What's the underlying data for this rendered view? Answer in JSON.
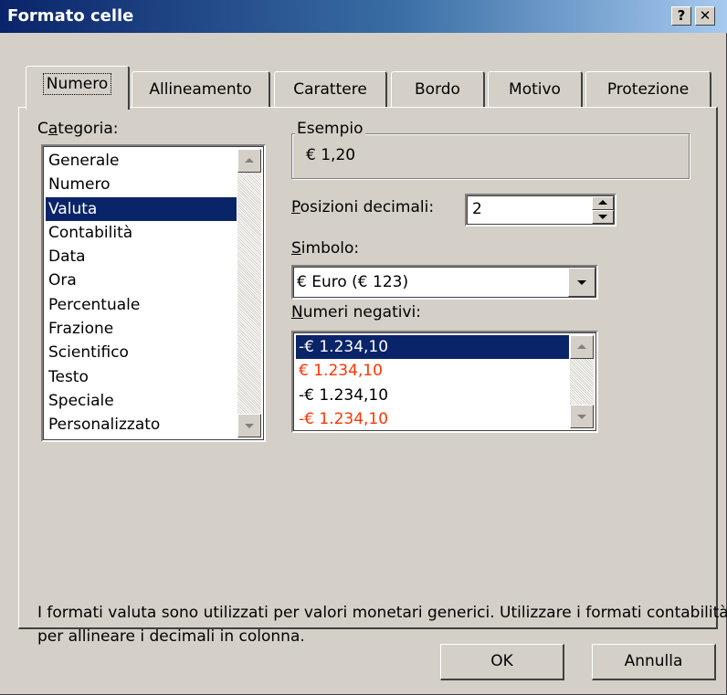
{
  "window": {
    "title": "Formato celle",
    "help_label": "?",
    "close_label": "✕"
  },
  "tabs": [
    {
      "label": "Numero",
      "active": true
    },
    {
      "label": "Allineamento"
    },
    {
      "label": "Carattere"
    },
    {
      "label": "Bordo"
    },
    {
      "label": "Motivo"
    },
    {
      "label": "Protezione"
    }
  ],
  "category": {
    "label_pre": "C",
    "label_ul": "a",
    "label_post": "tegoria:",
    "items": [
      "Generale",
      "Numero",
      "Valuta",
      "Contabilità",
      "Data",
      "Ora",
      "Percentuale",
      "Frazione",
      "Scientifico",
      "Testo",
      "Speciale",
      "Personalizzato"
    ],
    "selected": "Valuta"
  },
  "sample": {
    "title": "Esempio",
    "value": "€ 1,20"
  },
  "decimals": {
    "label_ul": "P",
    "label_post": "osizioni decimali:",
    "value": "2"
  },
  "symbol": {
    "label_ul": "S",
    "label_post": "imbolo:",
    "value": "€ Euro (€ 123)"
  },
  "negatives": {
    "label_ul": "N",
    "label_post": "umeri negativi:",
    "items": [
      {
        "text": "-€ 1.234,10",
        "red": false
      },
      {
        "text": "€ 1.234,10",
        "red": true
      },
      {
        "text": "-€ 1.234,10",
        "red": false
      },
      {
        "text": "-€ 1.234,10",
        "red": true
      }
    ]
  },
  "description": "I formati valuta sono utilizzati per valori  monetari generici. Utilizzare i formati contabilità per allineare i decimali in colonna.",
  "buttons": {
    "ok": "OK",
    "cancel": "Annulla"
  },
  "colors": {
    "title_start": "#0a246a",
    "selection": "#0a246a",
    "negative_red": "#ff3300",
    "face": "#d4d0c8"
  }
}
